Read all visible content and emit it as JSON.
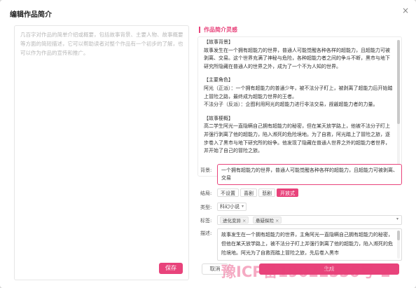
{
  "dialog": {
    "title": "编辑作品简介",
    "close_glyph": "×"
  },
  "left": {
    "placeholder": "几百字对作品的简单介绍或概要，包括故事背景、主要人物、故事概要等方面的简短描述，它可以帮助读者对整个作品有一个初步的了解，也可以作为作品的宣传和推广。",
    "save_label": "保存"
  },
  "inspiration": {
    "title": "作品简介灵感",
    "sections": [
      {
        "heading": "【故事背景】",
        "lines": [
          "故事发生在一个拥有超能力的世界，普通人可能觉醒各种各样的超能力，且超能力可被剥离、交易。这个世界充满了神秘与危险，各种超能力者之间的争斗不断，黑市与地下研究所隐藏在普通人的世界之外，成为了一个不为人知的世界。"
        ]
      },
      {
        "heading": "【主要角色】",
        "lines": [
          "阿光（正派）：一个拥有超能力的普通少年，被不法分子盯上，被剥离了超能力后开始踏上冒险之路，最终成为超能力世界的王者。",
          "不法分子（反派）：企图利用阿光的超能力进行非法交易，觊觎超能力者的力量。"
        ]
      },
      {
        "heading": "【故事梗概】",
        "lines": [
          "高二学生阿光一直隐瞒自己拥有超能力的秘密，但在某天放学路上，他被不法分子盯上并强行剥离了他的超能力，陷入濒死的危险境地。为了自救，阿光踏上了冒险之旅，逐步卷入了黑市与地下研究所的纷争。他发现了隐藏在普通人世界之外的超能力者世界，并开始了自己的冒险之旅。"
        ]
      }
    ]
  },
  "form": {
    "background_label": "背景:",
    "background_value": "一个拥有超能力的世界，普通人可能觉醒各种各样的超能力，且超能力可被剥离、交易",
    "ending_label": "结局:",
    "ending_options": [
      "不设置",
      "喜剧",
      "悲剧",
      "开放式"
    ],
    "ending_selected": "开放式",
    "type_label": "类型:",
    "type_value": "科幻小说",
    "tags_label": "标签:",
    "tags": [
      "进化变异",
      "悬疑探险"
    ],
    "desc_label": "描述:",
    "desc_value": "故事发生在一个拥有超能力的世界，主角阿光一直隐瞒自己拥有超能力的秘密，但他在某天放学路上，被不法分子盯上并强行剥离了他的超能力，陷入濒死的危险境地。阿光为了自救而踏上冒险之旅，先后卷入黑市",
    "cancel_label": "取消",
    "confirm_label": "生成"
  },
  "watermark": "豫ICP备19022556号-2",
  "colors": {
    "accent": "#e8437b"
  }
}
